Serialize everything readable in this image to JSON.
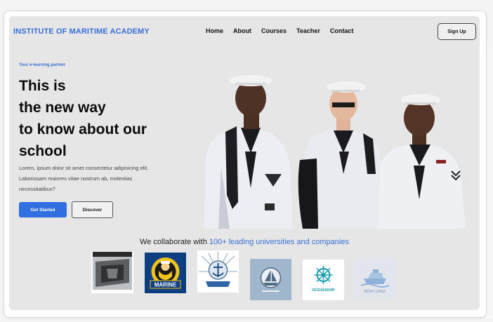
{
  "brand": "INSTITUTE OF MARITIME ACADEMY",
  "nav": {
    "home": "Home",
    "about": "About",
    "courses": "Courses",
    "teacher": "Teacher",
    "contact": "Contact",
    "signup": "Sign Up"
  },
  "hero": {
    "tagline": "Your e-learning partner",
    "headline": [
      "This is",
      "the new way",
      "to know about our",
      "school"
    ],
    "description": "Lorem, ipsum dolor sit amet consectetur adipisicing elit. Laboriosam maiores vitae nostrum ab, molestias necessitatibus?",
    "primary_button": "Get Started",
    "secondary_button": "Discover"
  },
  "collab": {
    "prefix": "We collaborate with",
    "highlight": "100+ leading universities and companies"
  },
  "logos": {
    "marine": "MARINE",
    "ocean_ship": "OCEANSHIP",
    "boat_logo": "BOAT LOGO"
  },
  "colors": {
    "accent": "#3a6fd8",
    "primary_button": "#2f6fe0",
    "panel": "#e6e6e6"
  }
}
